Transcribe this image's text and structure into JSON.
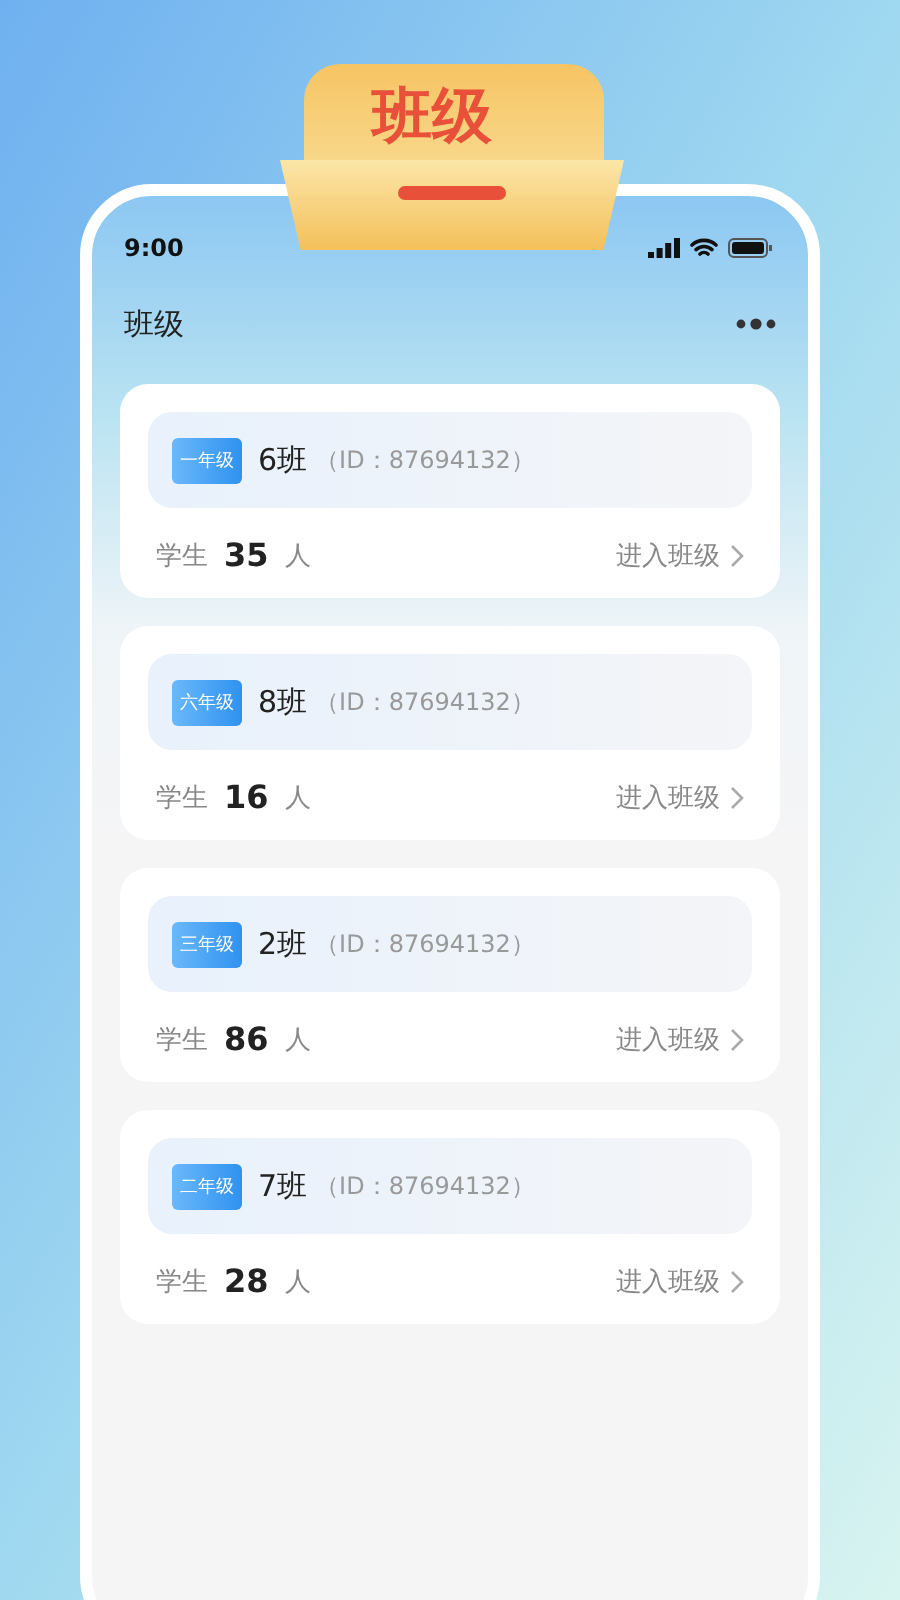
{
  "banner": {
    "title": "班级"
  },
  "status_bar": {
    "time": "9:00"
  },
  "header": {
    "title": "班级"
  },
  "classes": [
    {
      "grade": "一年级",
      "name": "6班",
      "id": "（ID：87694132）",
      "label": "学生",
      "count": "35",
      "unit": "人",
      "action": "进入班级"
    },
    {
      "grade": "六年级",
      "name": "8班",
      "id": "（ID：87694132）",
      "label": "学生",
      "count": "16",
      "unit": "人",
      "action": "进入班级"
    },
    {
      "grade": "三年级",
      "name": "2班",
      "id": "（ID：87694132）",
      "label": "学生",
      "count": "86",
      "unit": "人",
      "action": "进入班级"
    },
    {
      "grade": "二年级",
      "name": "7班",
      "id": "（ID：87694132）",
      "label": "学生",
      "count": "28",
      "unit": "人",
      "action": "进入班级"
    }
  ]
}
